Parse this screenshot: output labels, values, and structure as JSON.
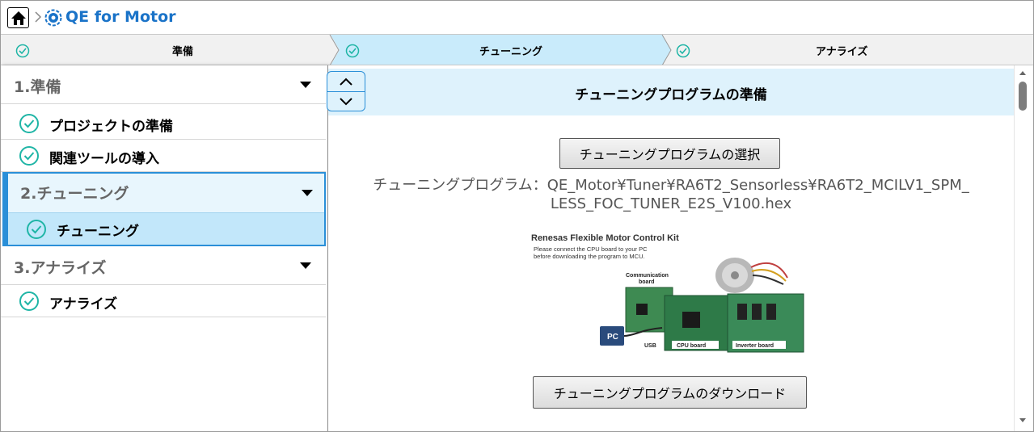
{
  "header": {
    "app_title": "QE for Motor",
    "home_icon": "home-icon",
    "logo_icon": "qe-logo-icon"
  },
  "steps": [
    {
      "label": "準備",
      "state": "done"
    },
    {
      "label": "チューニング",
      "state": "active"
    },
    {
      "label": "アナライズ",
      "state": "done"
    }
  ],
  "sidebar": {
    "sections": [
      {
        "title": "1.準備",
        "items": [
          {
            "label": "プロジェクトの準備"
          },
          {
            "label": "関連ツールの導入"
          }
        ]
      },
      {
        "title": "2.チューニング",
        "items": [
          {
            "label": "チューニング"
          }
        ]
      },
      {
        "title": "3.アナライズ",
        "items": [
          {
            "label": "アナライズ"
          }
        ]
      }
    ]
  },
  "main": {
    "title": "チューニングプログラムの準備",
    "select_button": "チューニングプログラムの選択",
    "program_path_line1": "チューニングプログラム：QE_Motor¥Tuner¥RA6T2_Sensorless¥RA6T2_MCILV1_SPM_",
    "program_path_line2": "LESS_FOC_TUNER_E2S_V100.hex",
    "download_button": "チューニングプログラムのダウンロード",
    "figure": {
      "title": "Renesas Flexible Motor Control Kit",
      "note_line1": "Please connect the CPU board to your PC",
      "note_line2": "before downloading the program to MCU.",
      "comm_label_line1": "Communication",
      "comm_label_line2": "board",
      "pc_label": "PC",
      "usb_label": "USB",
      "cpu_label": "CPU board",
      "inverter_label": "Inverter board"
    }
  },
  "colors": {
    "accent": "#2a8fd8",
    "title_blue": "#1a73c8",
    "check_teal": "#1fb5a6",
    "active_bg": "#c2e7fa"
  }
}
